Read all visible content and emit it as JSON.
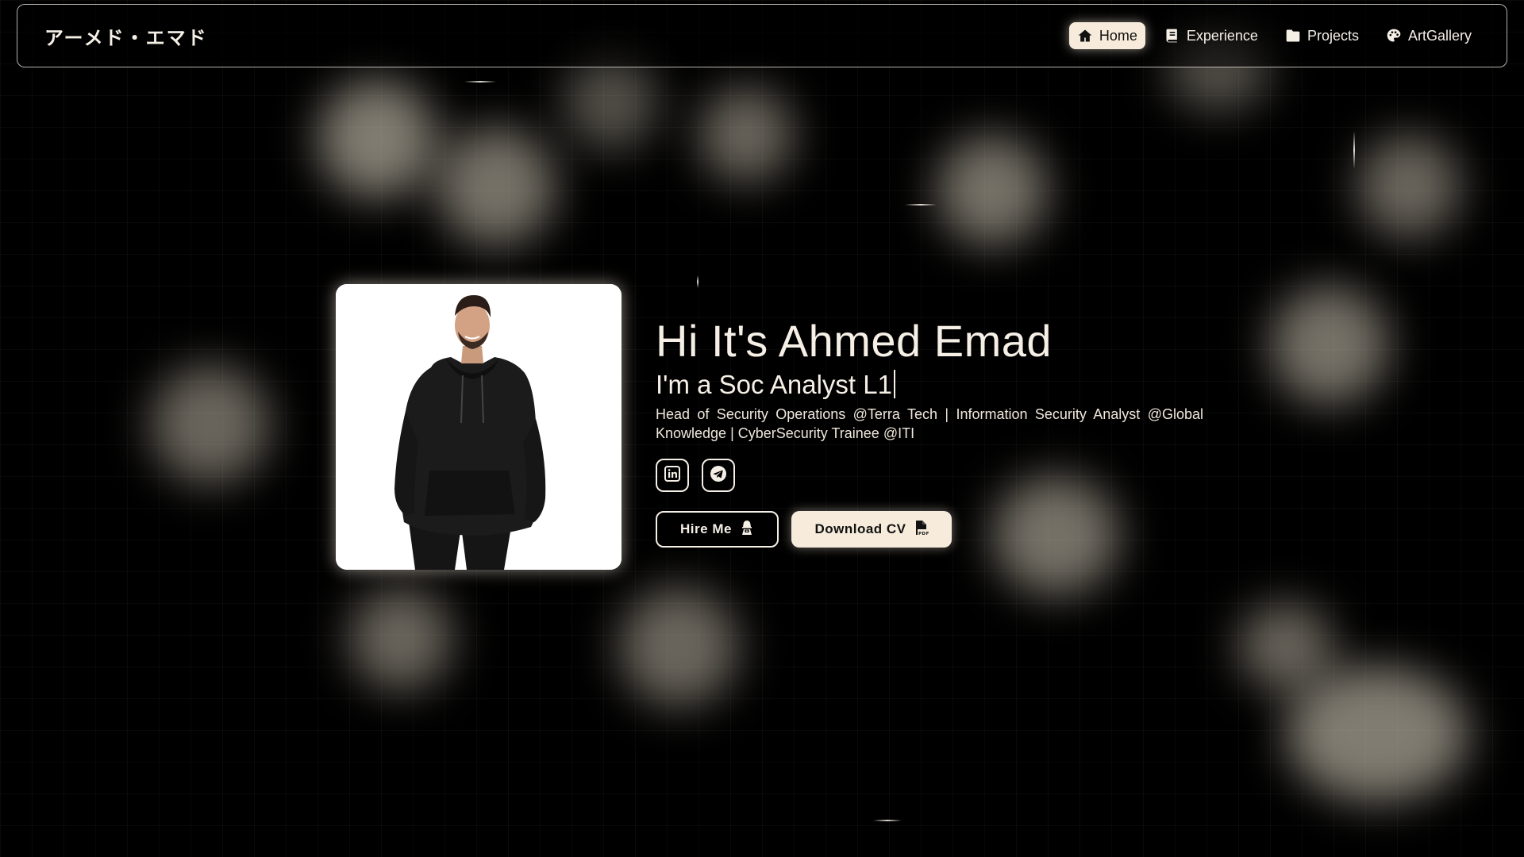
{
  "brand": {
    "title": "アーメド・エマド"
  },
  "nav": {
    "items": [
      {
        "label": "Home",
        "icon": "house-icon",
        "active": true
      },
      {
        "label": "Experience",
        "icon": "book-icon",
        "active": false
      },
      {
        "label": "Projects",
        "icon": "folder-icon",
        "active": false
      },
      {
        "label": "ArtGallery",
        "icon": "palette-icon",
        "active": false
      }
    ]
  },
  "hero": {
    "title": "Hi It's Ahmed Emad",
    "subtitle": "I'm a Soc Analyst L1",
    "description": "Head of Security Operations @Terra Tech | Information Security Analyst @Global Knowledge | CyberSecurity Trainee @ITI",
    "socials": [
      {
        "name": "linkedin",
        "icon": "linkedin-icon"
      },
      {
        "name": "telegram",
        "icon": "telegram-icon"
      }
    ],
    "buttons": {
      "hire_label": "Hire Me",
      "hire_icon": "hacker-icon",
      "cv_label": "Download CV",
      "cv_icon": "pdf-file-icon"
    }
  },
  "colors": {
    "background": "#000000",
    "accent": "#f7ecdc",
    "text": "#f5efe6"
  }
}
